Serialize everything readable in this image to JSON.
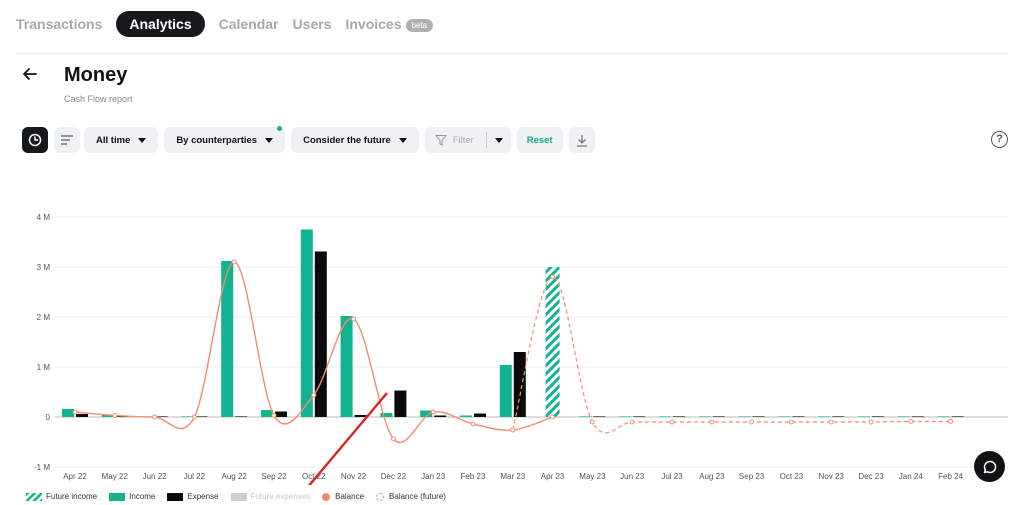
{
  "nav": {
    "tabs": [
      {
        "label": "Transactions"
      },
      {
        "label": "Analytics"
      },
      {
        "label": "Calendar"
      },
      {
        "label": "Users"
      },
      {
        "label": "Invoices",
        "badge": "beta"
      }
    ],
    "active": "Analytics"
  },
  "page": {
    "title": "Money",
    "subtitle": "Cash Flow report"
  },
  "toolbar": {
    "period": "All time",
    "grouping": "By counterparties",
    "future": "Consider the future",
    "filter_placeholder": "Filter",
    "reset": "Reset",
    "help": "?"
  },
  "colors": {
    "income": "#11b390",
    "expense": "#0b0b0b",
    "balance": "#f28c6e",
    "future_expense": "#cfcfcf",
    "accent": "#0fb392"
  },
  "icons": {
    "back": "arrow-left-icon",
    "chart_view": "pie-clock-icon",
    "list_view": "list-icon",
    "filter": "funnel-icon",
    "download": "download-icon",
    "chat": "chat-bubble-icon"
  },
  "chart_data": {
    "type": "bar",
    "x": [
      "Apr 22",
      "May 22",
      "Jun 22",
      "Jul 22",
      "Aug 22",
      "Sep 22",
      "Oct 22",
      "Nov 22",
      "Dec 22",
      "Jan 23",
      "Feb 23",
      "Mar 23",
      "Apr 23",
      "May 23",
      "Jun 23",
      "Jul 23",
      "Aug 23",
      "Sep 23",
      "Oct 23",
      "Nov 23",
      "Dec 23",
      "Jan 24",
      "Feb 24"
    ],
    "y_ticks": [
      "4 M",
      "3 M",
      "2 M",
      "1 M",
      "0",
      "-1 M"
    ],
    "ylim": [
      -1000000,
      4000000
    ],
    "series": [
      {
        "name": "Income",
        "values": [
          160000,
          40000,
          0,
          0,
          3120000,
          140000,
          3750000,
          2020000,
          80000,
          130000,
          30000,
          1040000,
          null,
          0,
          0,
          0,
          0,
          0,
          0,
          0,
          0,
          0,
          0
        ]
      },
      {
        "name": "Expense",
        "values": [
          60000,
          10000,
          0,
          0,
          10000,
          110000,
          3310000,
          40000,
          530000,
          30000,
          70000,
          1300000,
          null,
          0,
          0,
          0,
          0,
          0,
          0,
          0,
          0,
          0,
          0
        ]
      },
      {
        "name": "Future income",
        "values": [
          null,
          null,
          null,
          null,
          null,
          null,
          null,
          null,
          null,
          null,
          null,
          null,
          3000000,
          null,
          null,
          null,
          null,
          null,
          null,
          null,
          null,
          null,
          null
        ]
      },
      {
        "name": "Future expenses",
        "values": []
      },
      {
        "name": "Balance",
        "values": [
          100000,
          30000,
          0,
          0,
          3100000,
          30000,
          440000,
          1960000,
          -440000,
          100000,
          -140000,
          -260000,
          0,
          null,
          null,
          null,
          null,
          null,
          null,
          null,
          null,
          null,
          null
        ]
      },
      {
        "name": "Balance (future)",
        "values": [
          null,
          null,
          null,
          null,
          null,
          null,
          null,
          null,
          null,
          null,
          null,
          -260000,
          2800000,
          -100000,
          -100000,
          -100000,
          -100000,
          -100000,
          -100000,
          -100000,
          -100000,
          -90000,
          -90000
        ]
      }
    ],
    "legend": [
      "Future income",
      "Income",
      "Expense",
      "Future expenses",
      "Balance",
      "Balance (future)"
    ],
    "legend_position": "bottom-left",
    "grid": true
  }
}
